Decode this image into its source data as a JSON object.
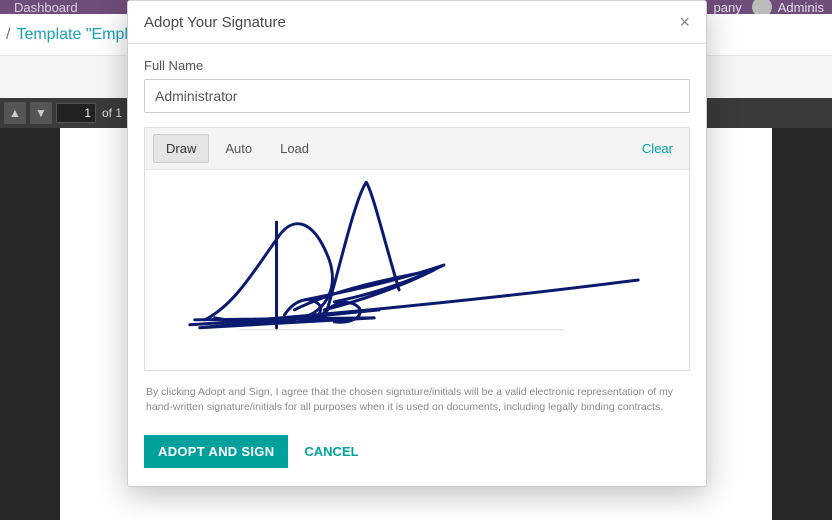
{
  "topbar": {
    "dashboard": "Dashboard",
    "company": "pany",
    "user": "Adminis"
  },
  "breadcrumb": {
    "sep": "/",
    "text": "Template \"Emplo"
  },
  "pager": {
    "page": "1",
    "of_label": "of 1"
  },
  "modal": {
    "title": "Adopt Your Signature",
    "full_name_label": "Full Name",
    "full_name_value": "Administrator",
    "tabs": {
      "draw": "Draw",
      "auto": "Auto",
      "load": "Load"
    },
    "clear": "Clear",
    "legal": "By clicking Adopt and Sign, I agree that the chosen signature/initials will be a valid electronic representation of my hand-written signature/initials for all purposes when it is used on documents, including legally binding contracts.",
    "adopt_btn": "ADOPT AND SIGN",
    "cancel_btn": "CANCEL"
  }
}
